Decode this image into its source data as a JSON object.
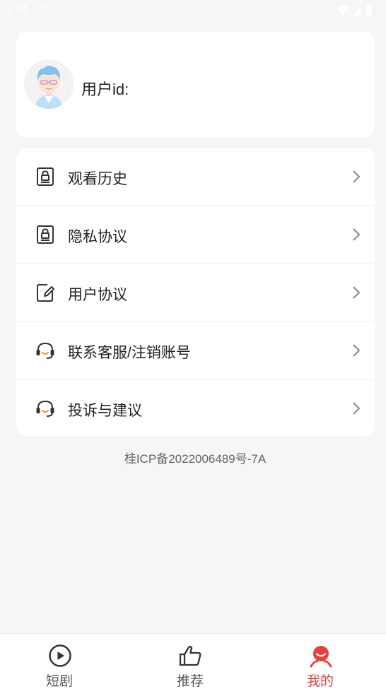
{
  "status_bar": {
    "time": "3:14"
  },
  "profile": {
    "user_id_label": "用户id:"
  },
  "menu": {
    "items": [
      {
        "label": "观看历史",
        "icon": "lock-document-icon"
      },
      {
        "label": "隐私协议",
        "icon": "lock-document-icon"
      },
      {
        "label": "用户协议",
        "icon": "edit-document-icon"
      },
      {
        "label": "联系客服/注销账号",
        "icon": "headset-icon"
      },
      {
        "label": "投诉与建议",
        "icon": "headset-icon"
      }
    ]
  },
  "footer": {
    "icp": "桂ICP备2022006489号-7A"
  },
  "bottom_nav": {
    "items": [
      {
        "label": "短剧",
        "icon": "play-circle-icon",
        "active": false
      },
      {
        "label": "推荐",
        "icon": "thumbs-up-icon",
        "active": false
      },
      {
        "label": "我的",
        "icon": "profile-icon",
        "active": true
      }
    ]
  },
  "colors": {
    "accent": "#e8403c",
    "background": "#f5f6f8",
    "card": "#ffffff"
  }
}
